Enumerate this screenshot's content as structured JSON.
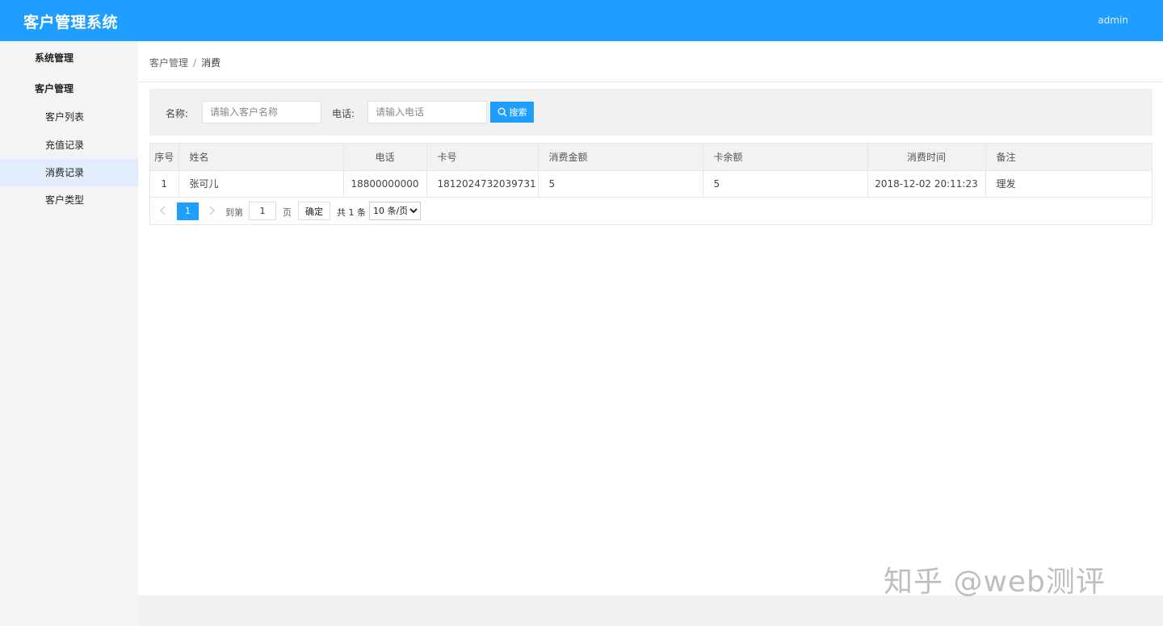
{
  "header": {
    "title": "客户管理系统",
    "user": "admin"
  },
  "sidebar": {
    "groups": [
      {
        "label": "系统管理"
      },
      {
        "label": "客户管理"
      }
    ],
    "items": [
      {
        "label": "客户列表"
      },
      {
        "label": "充值记录"
      },
      {
        "label": "消费记录",
        "active": true
      },
      {
        "label": "客户类型"
      }
    ]
  },
  "breadcrumb": {
    "parent": "客户管理",
    "separator": "/",
    "current": "消费"
  },
  "search": {
    "name_label": "名称:",
    "name_placeholder": "请输入客户名称",
    "name_value": "",
    "phone_label": "电话:",
    "phone_placeholder": "请输入电话",
    "phone_value": "",
    "button_label": "搜索",
    "button_icon": "search-icon"
  },
  "table": {
    "columns": [
      "序号",
      "姓名",
      "电话",
      "卡号",
      "消费金额",
      "卡余额",
      "消费时间",
      "备注"
    ],
    "rows": [
      [
        "1",
        "张可儿",
        "18800000000",
        "1812024732039731",
        "5",
        "5",
        "2018-12-02 20:11:23",
        "理发"
      ]
    ]
  },
  "pagination": {
    "prev_icon": "chevron-left-icon",
    "next_icon": "chevron-right-icon",
    "current_page": "1",
    "goto_label": "到第",
    "goto_value": "1",
    "page_unit": "页",
    "confirm_label": "确定",
    "total_label": "共 1 条",
    "page_size_selected": "10 条/页"
  },
  "watermark": "知乎 @web测评",
  "colors": {
    "primary": "#1e9fff",
    "sidebar_bg": "#f4f4f4",
    "active_item_bg": "#e2ecfb"
  }
}
